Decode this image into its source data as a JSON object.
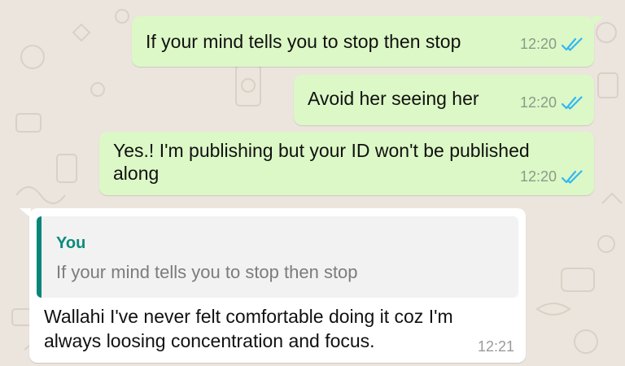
{
  "messages": [
    {
      "direction": "outgoing",
      "text": "If your mind tells you to stop then stop",
      "time": "12:20",
      "status": "read",
      "status_icon": "double-check-icon"
    },
    {
      "direction": "outgoing",
      "text": "Avoid her seeing her",
      "time": "12:20",
      "status": "read",
      "status_icon": "double-check-icon"
    },
    {
      "direction": "outgoing",
      "lines": [
        "Yes.! I'm publishing but your ID won't be published",
        "along"
      ],
      "time": "12:20",
      "status": "read",
      "status_icon": "double-check-icon"
    },
    {
      "direction": "incoming",
      "quoted": {
        "author": "You",
        "text": "If your mind tells you to stop then stop"
      },
      "lines": [
        "Wallahi I've never felt comfortable doing it coz I'm",
        "always loosing concentration and focus."
      ],
      "time": "12:21"
    }
  ],
  "colors": {
    "wallpaper": "#ece5dd",
    "outgoing_bubble": "#dcf8c6",
    "incoming_bubble": "#ffffff",
    "read_ticks": "#34b7f1",
    "quote_accent": "#07857a"
  }
}
